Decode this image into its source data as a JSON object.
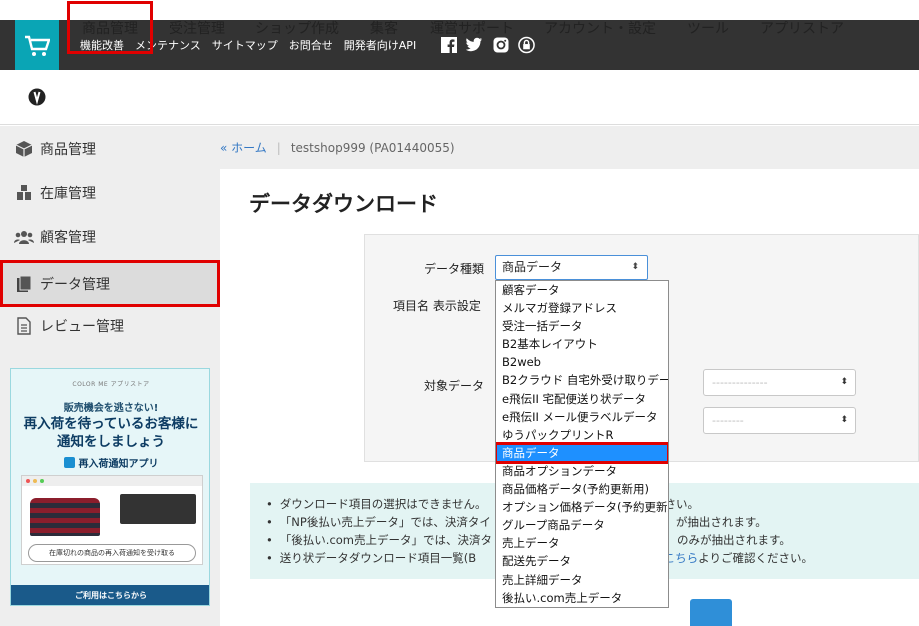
{
  "top_links": [
    "機能改善",
    "メンテナンス",
    "サイトマップ",
    "お問合せ",
    "開発者向けAPI"
  ],
  "social_icons": [
    "facebook-icon",
    "twitter-icon",
    "instagram-icon",
    "lock-icon"
  ],
  "main_nav": [
    "商品管理",
    "受注管理",
    "ショップ作成",
    "集客",
    "運営サポート",
    "アカウント・設定",
    "ツール",
    "アプリストア"
  ],
  "sidebar": {
    "items": [
      {
        "label": "商品管理",
        "icon": "box-icon"
      },
      {
        "label": "在庫管理",
        "icon": "warehouse-icon"
      },
      {
        "label": "顧客管理",
        "icon": "users-icon"
      },
      {
        "label": "データ管理",
        "icon": "document-icon"
      },
      {
        "label": "レビュー管理",
        "icon": "review-icon"
      }
    ],
    "banner": {
      "logo": "COLOR ME アプリストア",
      "subtitle": "販売機会を逃さない!",
      "headline_line1": "再入荷を待っているお客様に",
      "headline_line2": "通知をしましょう",
      "app_name": "再入荷通知アプリ",
      "pill": "在庫切れの商品の再入荷通知を受け取る",
      "footer": "ご利用はこちらから"
    }
  },
  "breadcrumb": {
    "home": "« ホーム",
    "shop": "testshop999 (PA01440055)"
  },
  "page_title": "データダウンロード",
  "form": {
    "data_type_label": "データ種類",
    "data_type_value": "商品データ",
    "item_name_label": "項目名 表示設定",
    "target_label": "対象データ",
    "target_placeholder1": "--------------",
    "target_placeholder2": "--------"
  },
  "dropdown_options": [
    "顧客データ",
    "メルマガ登録アドレス",
    "受注一括データ",
    "B2基本レイアウト",
    "B2web",
    "B2クラウド 自宅外受け取りデータ",
    "e飛伝II 宅配便送り状データ",
    "e飛伝II メール便ラベルデータ",
    "ゆうパックプリントR",
    "商品データ",
    "商品オプションデータ",
    "商品価格データ(予約更新用)",
    "オプション価格データ(予約更新用)",
    "グループ商品データ",
    "売上データ",
    "配送先データ",
    "売上詳細データ",
    "後払い.com売上データ"
  ],
  "dropdown_selected_index": 9,
  "info": {
    "line1_a": "ダウンロード項目の選択はできません。",
    "line1_b": "さい。",
    "line2_a": "「NP後払い売上データ」では、決済タイ",
    "line2_b": "が抽出されます。",
    "line3_a": "「後払い.com売上データ」では、決済タ",
    "line3_b": "のみが抽出されます。",
    "line4_a": "送り状データダウンロード項目一覧(B",
    "line4_link": "はこちら",
    "line4_b": "よりご確認ください。"
  }
}
